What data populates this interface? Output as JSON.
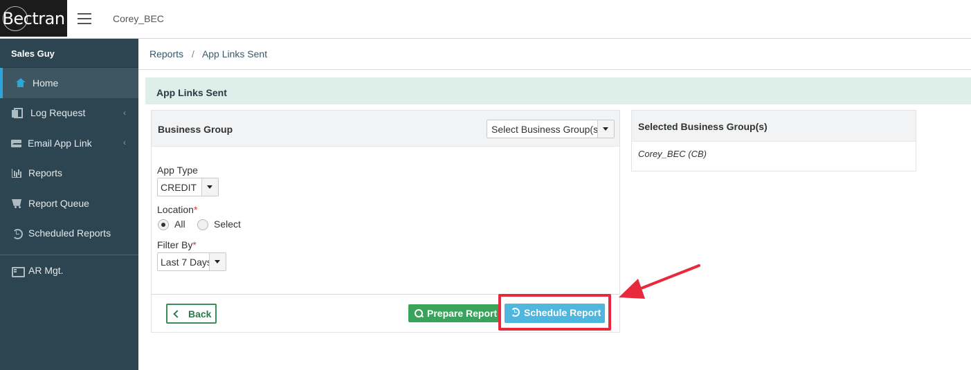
{
  "topbar": {
    "logo_text": "Bectran",
    "user": "Corey_BEC"
  },
  "sidebar": {
    "role": "Sales Guy",
    "items": [
      {
        "label": "Home",
        "icon": "home-icon",
        "active": true
      },
      {
        "label": "Log Request",
        "icon": "copy-icon",
        "has_children": true
      },
      {
        "label": "Email App Link",
        "icon": "envelope-icon",
        "has_children": true
      },
      {
        "label": "Reports",
        "icon": "bar-chart-icon"
      },
      {
        "label": "Report Queue",
        "icon": "cart-icon"
      },
      {
        "label": "Scheduled Reports",
        "icon": "history-icon"
      }
    ],
    "secondary": [
      {
        "label": "AR Mgt.",
        "icon": "id-card-icon"
      }
    ]
  },
  "breadcrumb": {
    "root": "Reports",
    "separator": "/",
    "current": "App Links Sent"
  },
  "page_title": "App Links Sent",
  "form": {
    "business_group_label": "Business Group",
    "business_group_select": "Select Business Group(s)",
    "app_type_label": "App Type",
    "app_type_value": "CREDIT",
    "location_label": "Location",
    "required_mark": "*",
    "location_options": [
      {
        "label": "All",
        "selected": true
      },
      {
        "label": "Select",
        "selected": false
      }
    ],
    "filter_label": "Filter By",
    "filter_value": "Last 7 Days"
  },
  "actions": {
    "back": "Back",
    "prepare": "Prepare Report",
    "schedule": "Schedule Report"
  },
  "selected_groups": {
    "title": "Selected Business Group(s)",
    "items": [
      "Corey_BEC (CB)"
    ]
  },
  "colors": {
    "sidebar_bg": "#2d4550",
    "accent_blue": "#2aa7d8",
    "prepare_green": "#3aa35b",
    "schedule_blue": "#4fb6dd",
    "annotation_red": "#e8283c",
    "title_bar_bg": "#deeee9"
  }
}
